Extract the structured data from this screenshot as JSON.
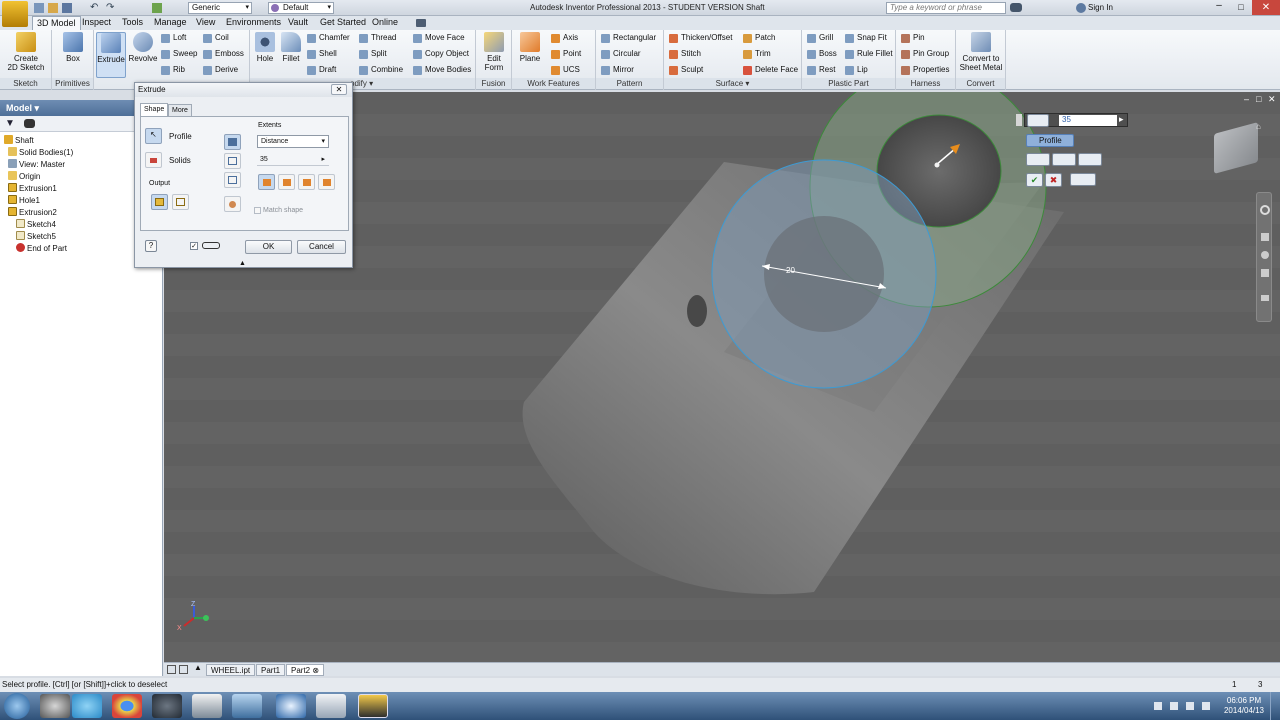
{
  "app": {
    "title": "Autodesk Inventor Professional 2013 - STUDENT VERSION   Shaft",
    "search_placeholder": "Type a keyword or phrase",
    "sign_in": "Sign In",
    "material": "Generic",
    "appearance": "Default"
  },
  "ribbon_tabs": [
    "3D Model",
    "Inspect",
    "Tools",
    "Manage",
    "View",
    "Environments",
    "Vault",
    "Get Started",
    "Online"
  ],
  "ribbon": {
    "sketch": {
      "label": "Sketch",
      "create": "Create\n2D Sketch"
    },
    "primitives": {
      "label": "Primitives",
      "box": "Box"
    },
    "create": {
      "extrude": "Extrude",
      "revolve": "Revolve",
      "loft": "Loft",
      "sweep": "Sweep",
      "rib": "Rib",
      "coil": "Coil",
      "emboss": "Emboss",
      "derive": "Derive"
    },
    "modify": {
      "label": "odify",
      "hole": "Hole",
      "fillet": "Fillet",
      "chamfer": "Chamfer",
      "shell": "Shell",
      "draft": "Draft",
      "thread": "Thread",
      "split": "Split",
      "combine": "Combine",
      "move_face": "Move Face",
      "copy_object": "Copy Object",
      "move_bodies": "Move Bodies"
    },
    "fusion": {
      "label": "Fusion",
      "edit_form": "Edit\nForm"
    },
    "work_features": {
      "label": "Work Features",
      "plane": "Plane",
      "axis": "Axis",
      "point": "Point",
      "ucs": "UCS"
    },
    "pattern": {
      "label": "Pattern",
      "rectangular": "Rectangular",
      "circular": "Circular",
      "mirror": "Mirror"
    },
    "surface": {
      "label": "Surface",
      "thicken": "Thicken/Offset",
      "stitch": "Stitch",
      "sculpt": "Sculpt",
      "patch": "Patch",
      "trim": "Trim",
      "delete_face": "Delete Face"
    },
    "plastic": {
      "label": "Plastic Part",
      "grill": "Grill",
      "boss": "Boss",
      "rest": "Rest",
      "snap_fit": "Snap Fit",
      "rule_fillet": "Rule Fillet",
      "lip": "Lip"
    },
    "harness": {
      "label": "Harness",
      "pin": "Pin",
      "pin_group": "Pin Group",
      "properties": "Properties"
    },
    "convert": {
      "label": "Convert",
      "sheet_metal": "Convert to\nSheet Metal"
    }
  },
  "browser": {
    "header": "Model",
    "items": [
      "Shaft",
      "Solid Bodies(1)",
      "View: Master",
      "Origin",
      "Extrusion1",
      "Hole1",
      "Extrusion2",
      "Sketch4",
      "Sketch5",
      "End of Part"
    ]
  },
  "dialog": {
    "title": "Extrude",
    "tab_shape": "Shape",
    "tab_more": "More",
    "profile": "Profile",
    "solids": "Solids",
    "output": "Output",
    "extents": "Extents",
    "extents_type": "Distance",
    "distance": "35",
    "match_shape": "Match shape",
    "ok": "OK",
    "cancel": "Cancel"
  },
  "viewport": {
    "dimension": "20",
    "minitool_value": "35",
    "minitool_profile": "Profile"
  },
  "doc_tabs": [
    "WHEEL.ipt",
    "Part1",
    "Part2"
  ],
  "status": {
    "message": "Select profile. [Ctrl] [or [Shift]]+click to deselect",
    "count_a": "1",
    "count_b": "3"
  },
  "clock": {
    "time": "06:06 PM",
    "date": "2014/04/13"
  }
}
